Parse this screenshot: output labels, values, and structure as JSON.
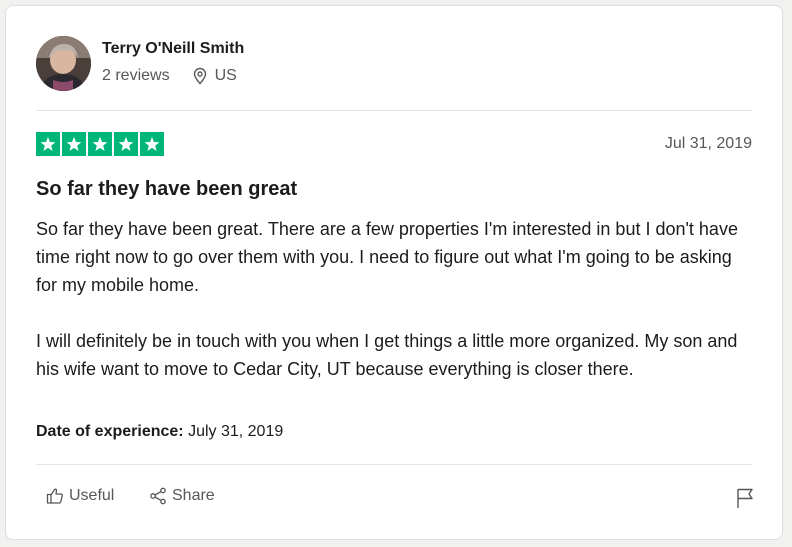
{
  "reviewer": {
    "name": "Terry O'Neill Smith",
    "reviews_count": "2 reviews",
    "country": "US"
  },
  "review": {
    "rating": 5,
    "max_rating": 5,
    "star_color": "#00b67a",
    "date": "Jul 31, 2019",
    "title": "So far they have been great",
    "paragraphs": [
      "So far they have been great. There are a few properties I'm interested in but I don't have time right now to go over them with you. I need to figure out what I'm going to be asking for my mobile home.",
      "I will definitely be in touch with you when I get things a little more organized. My son and his wife want to move to Cedar City, UT because everything is closer there."
    ],
    "experience_label": "Date of experience:",
    "experience_date": "July 31, 2019"
  },
  "actions": {
    "useful_label": "Useful",
    "share_label": "Share"
  },
  "icons": {
    "location": "location-pin-icon",
    "useful": "thumbs-up-icon",
    "share": "share-icon",
    "report": "flag-icon"
  }
}
